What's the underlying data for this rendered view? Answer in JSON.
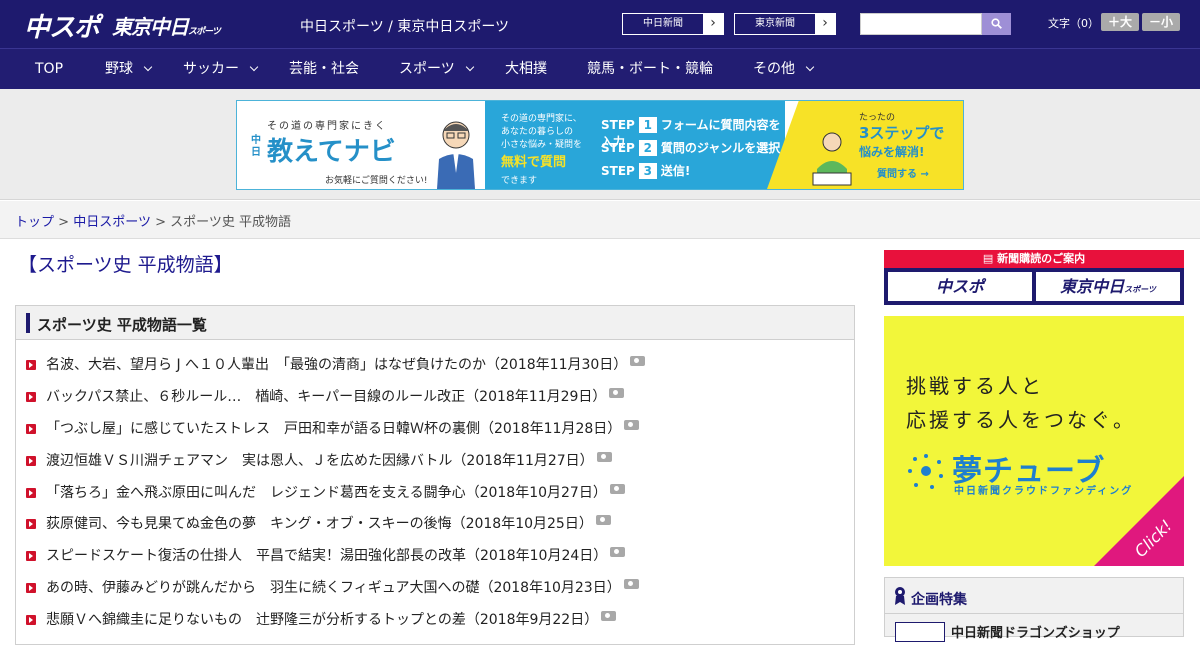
{
  "header": {
    "logo_main": "中スポ",
    "logo_tokyo": "東京中日",
    "logo_tokyo_suffix": "スポーツ",
    "subtitle": "中日スポーツ / 東京中日スポーツ",
    "paper_links": [
      "中日新聞",
      "東京新聞"
    ],
    "search": {
      "value": "",
      "placeholder": ""
    },
    "font_size_label": "文字（0）",
    "font_larger": "＋大",
    "font_smaller": "－小"
  },
  "nav": [
    {
      "label": "TOP",
      "has_menu": false
    },
    {
      "label": "野球",
      "has_menu": true
    },
    {
      "label": "サッカー",
      "has_menu": true
    },
    {
      "label": "芸能・社会",
      "has_menu": false
    },
    {
      "label": "スポーツ",
      "has_menu": true
    },
    {
      "label": "大相撲",
      "has_menu": false
    },
    {
      "label": "競馬・ボート・競輪",
      "has_menu": false
    },
    {
      "label": "その他",
      "has_menu": true
    }
  ],
  "ad": {
    "tagline": "その道の専門家にきく",
    "brand_prefix": "中日",
    "brand": "教えてナビ",
    "note": "お気軽にご質問ください!",
    "mid_lines": [
      "その道の専門家に、",
      "あなたの暮らしの",
      "小さな悩み・疑問を"
    ],
    "mid_highlight": "無料で質問",
    "mid_end": "できます",
    "steps": [
      {
        "label": "STEP",
        "num": "1",
        "text": "フォームに質問内容を入力"
      },
      {
        "label": "STEP",
        "num": "2",
        "text": "質問のジャンルを選択"
      },
      {
        "label": "STEP",
        "num": "3",
        "text": "送信!"
      }
    ],
    "right_small": "たったの",
    "right_big": "3ステップで",
    "right_sub": "悩みを解消!",
    "right_btn": "質問する"
  },
  "breadcrumb": {
    "home": "トップ",
    "section": "中日スポーツ",
    "current": "スポーツ史 平成物語",
    "sep": ">"
  },
  "main": {
    "heading": "【スポーツ史 平成物語】",
    "list_title": "スポーツ史 平成物語一覧",
    "articles": [
      "名波、大岩、望月ら J へ１０人輩出　「最強の清商」はなぜ負けたのか（2018年11月30日）",
      "バックパス禁止、６秒ルール…　楢崎、キーパー目線のルール改正（2018年11月29日）",
      "「つぶし屋」に感じていたストレス　戸田和幸が語る日韓Ｗ杯の裏側（2018年11月28日）",
      "渡辺恒雄ＶＳ川淵チェアマン　実は恩人、Ｊを広めた因縁バトル（2018年11月27日）",
      "「落ちろ」金へ飛ぶ原田に叫んだ　レジェンド葛西を支える闘争心（2018年10月27日）",
      "荻原健司、今も見果てぬ金色の夢　キング・オブ・スキーの後悔（2018年10月25日）",
      "スピードスケート復活の仕掛人　平昌で結実！湯田強化部長の改革（2018年10月24日）",
      "あの時、伊藤みどりが跳んだから　羽生に続くフィギュア大国への礎（2018年10月23日）",
      "悲願Ｖへ錦織圭に足りないもの　辻野隆三が分析するトップとの差（2018年9月22日）"
    ]
  },
  "sidebar": {
    "subscribe_title": "新聞購読のご案内",
    "subscribe_chuspo": "中スポ",
    "subscribe_tokyo": "東京中日",
    "subscribe_tokyo_suffix": "スポーツ",
    "yume_line1": "挑戦する人と",
    "yume_line2": "応援する人をつなぐ。",
    "yume_logo": "夢チューブ",
    "yume_sub": "中日新聞クラウドファンディング",
    "yume_click": "Click!",
    "kikaku_title": "企画特集",
    "kikaku_item": "中日新聞ドラゴンズショップ"
  },
  "colors": {
    "header_bg": "#1e1a6e",
    "accent_red": "#d0112b",
    "link": "#1a1aa6",
    "ad_blue": "#29a6d9",
    "ad_yellow": "#f7e227",
    "yume_yellow": "#f2f63a",
    "click_pink": "#e0187e"
  }
}
